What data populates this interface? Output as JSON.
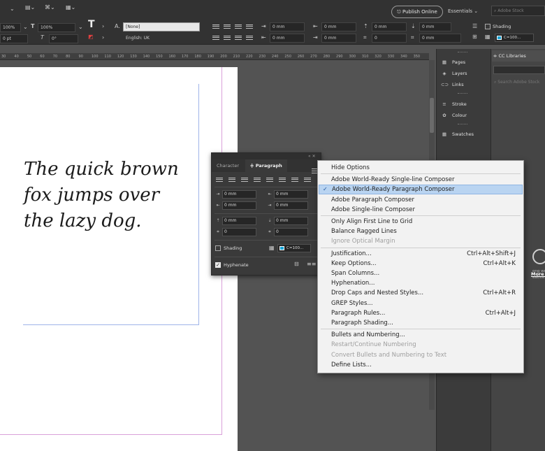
{
  "control_bar": {
    "scale_1": "100%",
    "scale_2": "100%",
    "tracking": "0 pt",
    "skew": "0°",
    "char_style": "[None]",
    "language": "English: UK",
    "indent_fields": [
      "0 mm",
      "0 mm",
      "0 mm",
      "0 mm",
      "0 mm",
      "0 mm",
      "0",
      "0 mm",
      "0 mm"
    ],
    "shading_label": "Shading",
    "swatch_label": "C=100...",
    "publish_online": "Publish Online",
    "workspace": "Essentials",
    "search_placeholder": "Adobe Stock"
  },
  "ruler": {
    "ticks": [
      "30",
      "40",
      "50",
      "60",
      "70",
      "80",
      "90",
      "100",
      "110",
      "120",
      "130",
      "140",
      "150",
      "160",
      "170",
      "180",
      "190",
      "200",
      "210",
      "220",
      "230",
      "240",
      "250",
      "260",
      "270",
      "280",
      "290",
      "300",
      "310",
      "320",
      "330",
      "340",
      "350"
    ]
  },
  "document": {
    "lines": [
      "The quick brown",
      "fox jumps over",
      "the lazy dog."
    ]
  },
  "dock": {
    "items": [
      {
        "icon": "pages-icon",
        "glyph": "▦",
        "label": "Pages"
      },
      {
        "icon": "layers-icon",
        "glyph": "◈",
        "label": "Layers"
      },
      {
        "icon": "links-icon",
        "glyph": "⊂⊃",
        "label": "Links"
      },
      {
        "icon": "stroke-icon",
        "glyph": "≡",
        "label": "Stroke"
      },
      {
        "icon": "colour-icon",
        "glyph": "✿",
        "label": "Colour"
      },
      {
        "icon": "swatches-icon",
        "glyph": "▦",
        "label": "Swatches"
      }
    ]
  },
  "cc_libraries": {
    "tab": "CC Libraries",
    "search_placeholder": "Search Adobe Stock",
    "body_text": [
      "ong went w",
      "eative Clo"
    ],
    "more_info": "More info"
  },
  "paragraph_panel": {
    "tab_character": "Character",
    "tab_paragraph": "Paragraph",
    "fields": [
      "0 mm",
      "0 mm",
      "0 mm",
      "0 mm",
      "0 mm",
      "0 mm",
      "0",
      "0"
    ],
    "shading_label": "Shading",
    "swatch_label": "C=100...",
    "hyphenate_label": "Hyphenate"
  },
  "context_menu": {
    "items": [
      {
        "label": "Hide Options",
        "shortcut": "",
        "disabled": false,
        "checked": false,
        "hover": false
      },
      {
        "label": "Adobe World-Ready Single-line Composer",
        "shortcut": "",
        "disabled": false,
        "checked": false,
        "hover": false
      },
      {
        "label": "Adobe World-Ready Paragraph Composer",
        "shortcut": "",
        "disabled": false,
        "checked": true,
        "hover": true
      },
      {
        "label": "Adobe Paragraph Composer",
        "shortcut": "",
        "disabled": false,
        "checked": false,
        "hover": false
      },
      {
        "label": "Adobe Single-line Composer",
        "shortcut": "",
        "disabled": false,
        "checked": false,
        "hover": false
      },
      {
        "label": "Only Align First Line to Grid",
        "shortcut": "",
        "disabled": false,
        "checked": false,
        "hover": false
      },
      {
        "label": "Balance Ragged Lines",
        "shortcut": "",
        "disabled": false,
        "checked": false,
        "hover": false
      },
      {
        "label": "Ignore Optical Margin",
        "shortcut": "",
        "disabled": true,
        "checked": false,
        "hover": false
      },
      {
        "label": "Justification...",
        "shortcut": "Ctrl+Alt+Shift+J",
        "disabled": false,
        "checked": false,
        "hover": false
      },
      {
        "label": "Keep Options...",
        "shortcut": "Ctrl+Alt+K",
        "disabled": false,
        "checked": false,
        "hover": false
      },
      {
        "label": "Span Columns...",
        "shortcut": "",
        "disabled": false,
        "checked": false,
        "hover": false
      },
      {
        "label": "Hyphenation...",
        "shortcut": "",
        "disabled": false,
        "checked": false,
        "hover": false
      },
      {
        "label": "Drop Caps and Nested Styles...",
        "shortcut": "Ctrl+Alt+R",
        "disabled": false,
        "checked": false,
        "hover": false
      },
      {
        "label": "GREP Styles...",
        "shortcut": "",
        "disabled": false,
        "checked": false,
        "hover": false
      },
      {
        "label": "Paragraph Rules...",
        "shortcut": "Ctrl+Alt+J",
        "disabled": false,
        "checked": false,
        "hover": false
      },
      {
        "label": "Paragraph Shading...",
        "shortcut": "",
        "disabled": false,
        "checked": false,
        "hover": false
      },
      {
        "label": "Bullets and Numbering...",
        "shortcut": "",
        "disabled": false,
        "checked": false,
        "hover": false
      },
      {
        "label": "Restart/Continue Numbering",
        "shortcut": "",
        "disabled": true,
        "checked": false,
        "hover": false
      },
      {
        "label": "Convert Bullets and Numbering to Text",
        "shortcut": "",
        "disabled": true,
        "checked": false,
        "hover": false
      },
      {
        "label": "Define Lists...",
        "shortcut": "",
        "disabled": false,
        "checked": false,
        "hover": false
      }
    ]
  },
  "colors": {
    "ui_dark": "#323232",
    "pasteboard": "#535353",
    "menu_bg": "#f2f2f2",
    "menu_hover": "#b9d4f1",
    "swatch_cyan": "#1aa4d6",
    "margin_guide": "#9fb4e8",
    "bleed_guide": "#d9a0d9"
  }
}
